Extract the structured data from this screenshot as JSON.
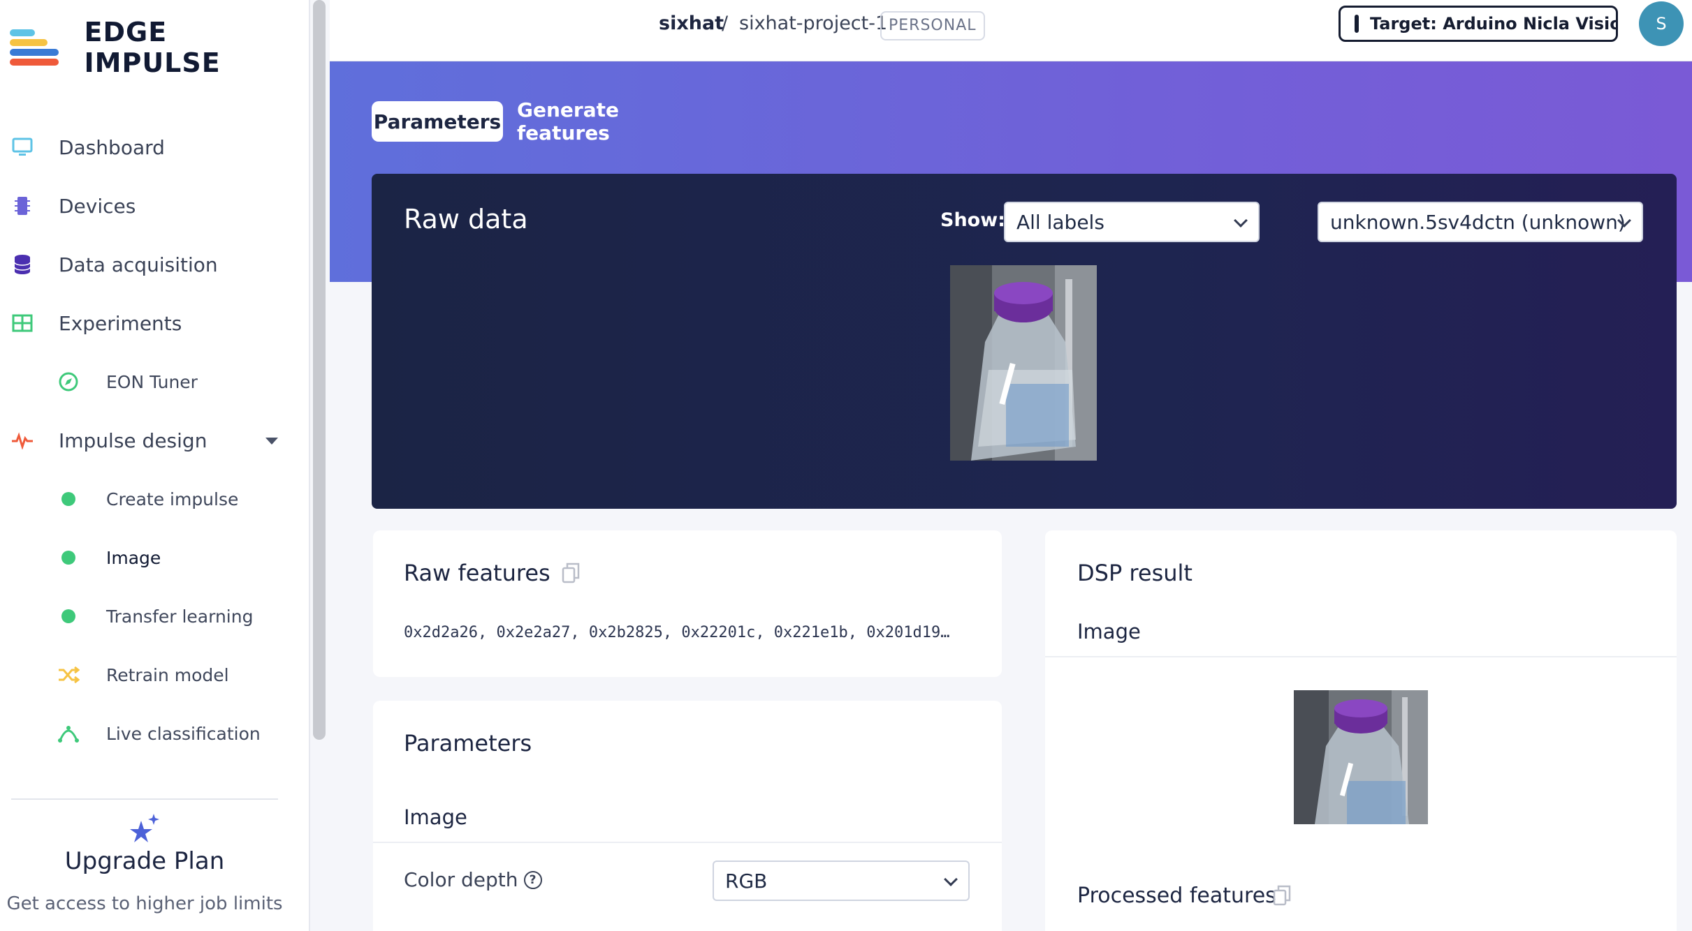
{
  "brand": {
    "name": "EDGE IMPULSE"
  },
  "sidebar": {
    "items": [
      {
        "label": "Dashboard"
      },
      {
        "label": "Devices"
      },
      {
        "label": "Data acquisition"
      },
      {
        "label": "Experiments"
      },
      {
        "label": "EON Tuner"
      },
      {
        "label": "Impulse design"
      },
      {
        "label": "Create impulse"
      },
      {
        "label": "Image"
      },
      {
        "label": "Transfer learning"
      },
      {
        "label": "Retrain model"
      },
      {
        "label": "Live classification"
      }
    ],
    "upgrade": {
      "title": "Upgrade Plan",
      "description": "Get access to higher job limits"
    }
  },
  "header": {
    "user": "sixhat",
    "separator": "/",
    "project": "sixhat-project-1",
    "badge": "PERSONAL",
    "target": "Target: Arduino Nicla Visio...",
    "avatar_initial": "S"
  },
  "tabs": [
    {
      "label": "Parameters"
    },
    {
      "label": "Generate features"
    }
  ],
  "raw_data": {
    "title": "Raw data",
    "show_label": "Show:",
    "label_filter": "All labels",
    "sample": "unknown.5sv4dctn (unknown)"
  },
  "raw_features": {
    "title": "Raw features",
    "values": "0x2d2a26, 0x2e2a27, 0x2b2825, 0x22201c, 0x221e1b, 0x201d19…"
  },
  "parameters": {
    "title": "Parameters",
    "section": "Image",
    "color_depth_label": "Color depth",
    "color_depth_value": "RGB"
  },
  "dsp_result": {
    "title": "DSP result",
    "section": "Image",
    "processed_label": "Processed features"
  },
  "colors": {
    "accent": "#6a63d8",
    "panel": "#1d2448",
    "active_dot": "#3ec97a"
  }
}
